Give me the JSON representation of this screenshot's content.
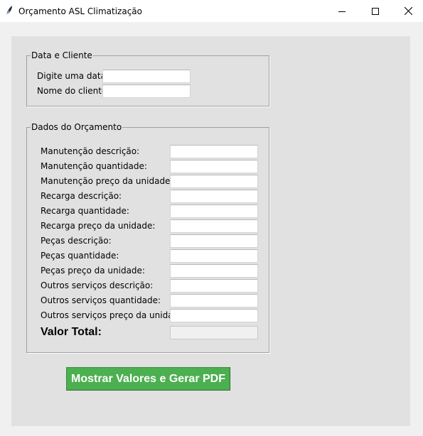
{
  "window": {
    "title": "Orçamento ASL Climatização",
    "icon": "feather-icon",
    "controls": [
      "minimize-icon",
      "maximize-icon",
      "close-icon"
    ]
  },
  "date_client": {
    "legend": "Data e Cliente",
    "fields": [
      {
        "label": "Digite uma data",
        "value": ""
      },
      {
        "label": "Nome do cliente",
        "value": ""
      }
    ]
  },
  "budget": {
    "legend": "Dados do Orçamento",
    "fields": [
      {
        "label": "Manutenção descrição:",
        "value": ""
      },
      {
        "label": "Manutenção quantidade:",
        "value": ""
      },
      {
        "label": "Manutenção preço da unidade:",
        "value": ""
      },
      {
        "label": "Recarga descrição:",
        "value": ""
      },
      {
        "label": "Recarga quantidade:",
        "value": ""
      },
      {
        "label": "Recarga preço da unidade:",
        "value": ""
      },
      {
        "label": "Peças descrição:",
        "value": ""
      },
      {
        "label": "Peças quantidade:",
        "value": ""
      },
      {
        "label": "Peças preço da unidade:",
        "value": ""
      },
      {
        "label": "Outros serviços descrição:",
        "value": ""
      },
      {
        "label": "Outros serviços quantidade:",
        "value": ""
      },
      {
        "label": "Outros serviços preço da unidade:",
        "value": ""
      }
    ],
    "total_label": "Valor Total:",
    "total_value": ""
  },
  "action": {
    "button_label": "Mostrar Valores e Gerar PDF",
    "button_color": "#4caf50",
    "button_text_color": "#ffffff"
  }
}
